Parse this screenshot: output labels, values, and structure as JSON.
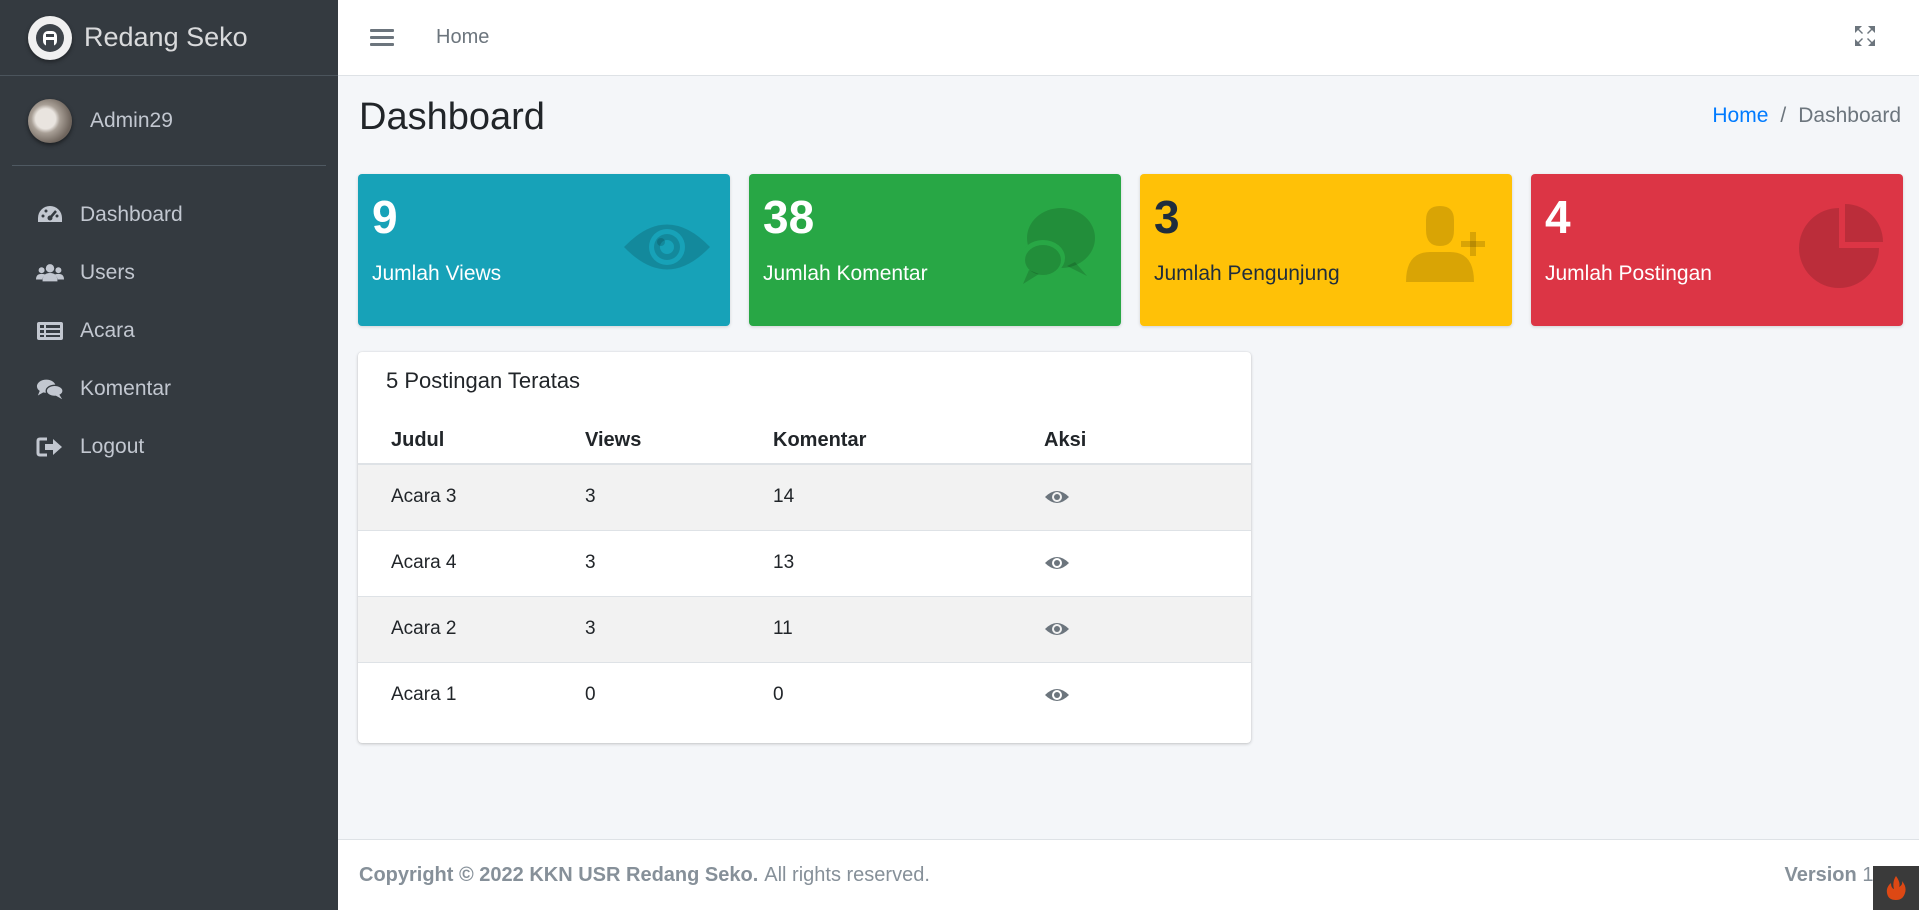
{
  "brand": {
    "name": "Redang Seko"
  },
  "user": {
    "name": "Admin29"
  },
  "sidebar": {
    "items": [
      {
        "label": "Dashboard",
        "icon": "tachometer-icon"
      },
      {
        "label": "Users",
        "icon": "users-icon"
      },
      {
        "label": "Acara",
        "icon": "list-alt-icon"
      },
      {
        "label": "Komentar",
        "icon": "comments-icon"
      },
      {
        "label": "Logout",
        "icon": "sign-out-icon"
      }
    ]
  },
  "topbar": {
    "home_label": "Home"
  },
  "header": {
    "title": "Dashboard",
    "breadcrumb": {
      "home": "Home",
      "separator": "/",
      "current": "Dashboard"
    }
  },
  "stats": [
    {
      "value": "9",
      "label": "Jumlah Views",
      "icon": "eye-icon",
      "color": "#17a2b8"
    },
    {
      "value": "38",
      "label": "Jumlah Komentar",
      "icon": "comments-icon",
      "color": "#28a745"
    },
    {
      "value": "3",
      "label": "Jumlah Pengunjung",
      "icon": "user-plus-icon",
      "color": "#ffc107"
    },
    {
      "value": "4",
      "label": "Jumlah Postingan",
      "icon": "pie-chart-icon",
      "color": "#dc3545"
    }
  ],
  "top_posts": {
    "title": "5 Postingan Teratas",
    "columns": [
      "Judul",
      "Views",
      "Komentar",
      "Aksi"
    ],
    "rows": [
      {
        "judul": "Acara 3",
        "views": "3",
        "komentar": "14"
      },
      {
        "judul": "Acara 4",
        "views": "3",
        "komentar": "13"
      },
      {
        "judul": "Acara 2",
        "views": "3",
        "komentar": "11"
      },
      {
        "judul": "Acara 1",
        "views": "0",
        "komentar": "0"
      }
    ]
  },
  "footer": {
    "copyright": "Copyright © 2022 KKN USR Redang Seko.",
    "rights": "All rights reserved.",
    "version_label": "Version",
    "version_value": "1."
  }
}
